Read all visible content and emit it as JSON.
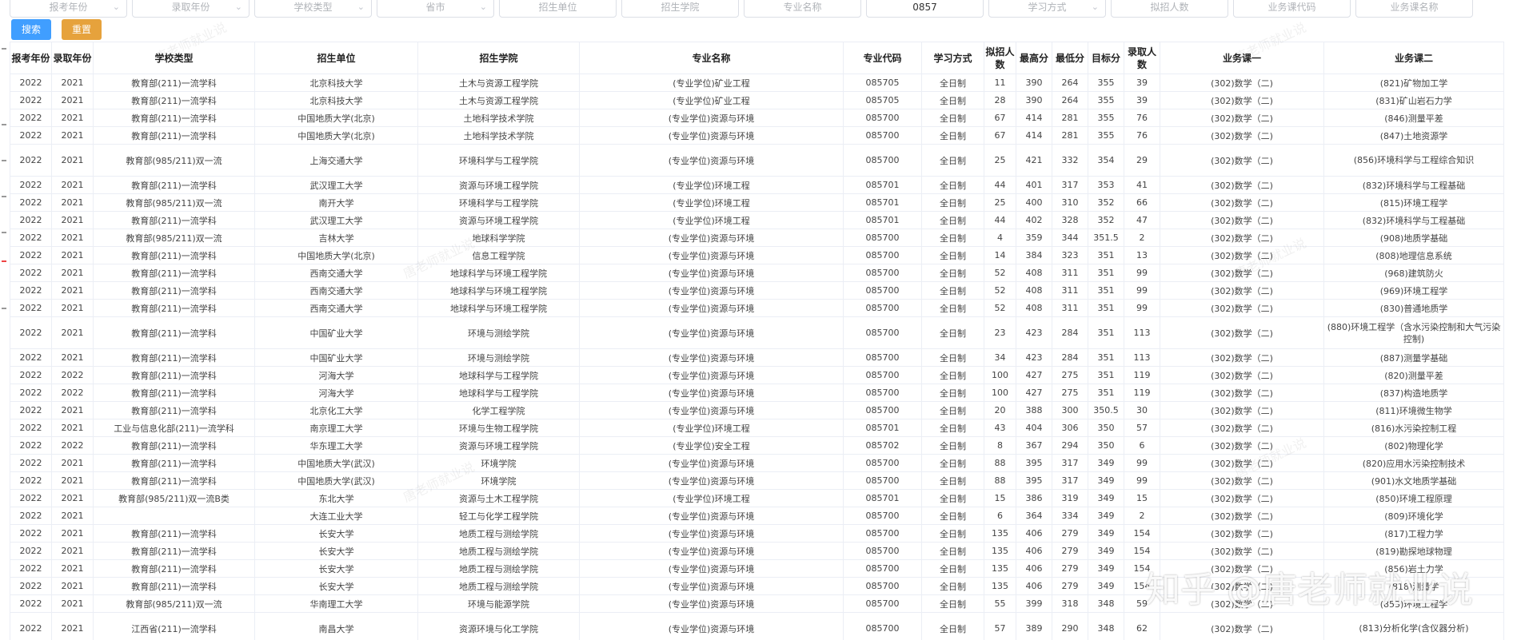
{
  "filters": [
    {
      "placeholder": "报考年份",
      "value": "",
      "dropdown": true
    },
    {
      "placeholder": "录取年份",
      "value": "",
      "dropdown": true
    },
    {
      "placeholder": "学校类型",
      "value": "",
      "dropdown": true
    },
    {
      "placeholder": "省市",
      "value": "",
      "dropdown": true
    },
    {
      "placeholder": "招生单位",
      "value": "",
      "dropdown": false
    },
    {
      "placeholder": "招生学院",
      "value": "",
      "dropdown": false
    },
    {
      "placeholder": "专业名称",
      "value": "",
      "dropdown": false
    },
    {
      "placeholder": "",
      "value": "0857",
      "dropdown": false
    },
    {
      "placeholder": "学习方式",
      "value": "",
      "dropdown": true
    },
    {
      "placeholder": "拟招人数",
      "value": "",
      "dropdown": false
    },
    {
      "placeholder": "业务课代码",
      "value": "",
      "dropdown": false
    },
    {
      "placeholder": "业务课名称",
      "value": "",
      "dropdown": false
    }
  ],
  "buttons": {
    "search": "搜索",
    "reset": "重置"
  },
  "columns": [
    "报考年份",
    "录取年份",
    "学校类型",
    "招生单位",
    "招生学院",
    "专业名称",
    "专业代码",
    "学习方式",
    "拟招人数",
    "最高分",
    "最低分",
    "目标分",
    "录取人数",
    "业务课一",
    "业务课二"
  ],
  "rows": [
    [
      "2022",
      "2021",
      "教育部(211)一流学科",
      "北京科技大学",
      "土木与资源工程学院",
      "(专业学位)矿业工程",
      "085705",
      "全日制",
      "11",
      "390",
      "264",
      "355",
      "39",
      "(302)数学（二)",
      "(821)矿物加工学"
    ],
    [
      "2022",
      "2021",
      "教育部(211)一流学科",
      "北京科技大学",
      "土木与资源工程学院",
      "(专业学位)矿业工程",
      "085705",
      "全日制",
      "28",
      "390",
      "264",
      "355",
      "39",
      "(302)数学（二)",
      "(831)矿山岩石力学"
    ],
    [
      "2022",
      "2021",
      "教育部(211)一流学科",
      "中国地质大学(北京)",
      "土地科学技术学院",
      "(专业学位)资源与环境",
      "085700",
      "全日制",
      "67",
      "414",
      "281",
      "355",
      "76",
      "(302)数学（二)",
      "(846)测量平差"
    ],
    [
      "2022",
      "2021",
      "教育部(211)一流学科",
      "中国地质大学(北京)",
      "土地科学技术学院",
      "(专业学位)资源与环境",
      "085700",
      "全日制",
      "67",
      "414",
      "281",
      "355",
      "76",
      "(302)数学（二)",
      "(847)土地资源学"
    ],
    [
      "2022",
      "2021",
      "教育部(985/211)双一流",
      "上海交通大学",
      "环境科学与工程学院",
      "(专业学位)资源与环境",
      "085700",
      "全日制",
      "25",
      "421",
      "332",
      "354",
      "29",
      "(302)数学（二)",
      "(856)环境科学与工程综合知识"
    ],
    [
      "2022",
      "2021",
      "教育部(211)一流学科",
      "武汉理工大学",
      "资源与环境工程学院",
      "(专业学位)环境工程",
      "085701",
      "全日制",
      "44",
      "401",
      "317",
      "353",
      "41",
      "(302)数学（二)",
      "(832)环境科学与工程基础"
    ],
    [
      "2022",
      "2021",
      "教育部(985/211)双一流",
      "南开大学",
      "环境科学与工程学院",
      "(专业学位)环境工程",
      "085701",
      "全日制",
      "25",
      "400",
      "310",
      "352",
      "66",
      "(302)数学（二)",
      "(815)环境工程学"
    ],
    [
      "2022",
      "2021",
      "教育部(211)一流学科",
      "武汉理工大学",
      "资源与环境工程学院",
      "(专业学位)环境工程",
      "085701",
      "全日制",
      "44",
      "402",
      "328",
      "352",
      "47",
      "(302)数学（二)",
      "(832)环境科学与工程基础"
    ],
    [
      "2022",
      "2021",
      "教育部(985/211)双一流",
      "吉林大学",
      "地球科学学院",
      "(专业学位)资源与环境",
      "085700",
      "全日制",
      "4",
      "359",
      "344",
      "351.5",
      "2",
      "(302)数学（二)",
      "(908)地质学基础"
    ],
    [
      "2022",
      "2021",
      "教育部(211)一流学科",
      "中国地质大学(北京)",
      "信息工程学院",
      "(专业学位)资源与环境",
      "085700",
      "全日制",
      "14",
      "384",
      "323",
      "351",
      "13",
      "(302)数学（二)",
      "(808)地理信息系统"
    ],
    [
      "2022",
      "2021",
      "教育部(211)一流学科",
      "西南交通大学",
      "地球科学与环境工程学院",
      "(专业学位)资源与环境",
      "085700",
      "全日制",
      "52",
      "408",
      "311",
      "351",
      "99",
      "(302)数学（二)",
      "(968)建筑防火"
    ],
    [
      "2022",
      "2021",
      "教育部(211)一流学科",
      "西南交通大学",
      "地球科学与环境工程学院",
      "(专业学位)资源与环境",
      "085700",
      "全日制",
      "52",
      "408",
      "311",
      "351",
      "99",
      "(302)数学（二)",
      "(969)环境工程学"
    ],
    [
      "2022",
      "2021",
      "教育部(211)一流学科",
      "西南交通大学",
      "地球科学与环境工程学院",
      "(专业学位)资源与环境",
      "085700",
      "全日制",
      "52",
      "408",
      "311",
      "351",
      "99",
      "(302)数学（二)",
      "(830)普通地质学"
    ],
    [
      "2022",
      "2021",
      "教育部(211)一流学科",
      "中国矿业大学",
      "环境与测绘学院",
      "(专业学位)资源与环境",
      "085700",
      "全日制",
      "23",
      "423",
      "284",
      "351",
      "113",
      "(302)数学（二)",
      "(880)环境工程学（含水污染控制和大气污染控制)"
    ],
    [
      "2022",
      "2021",
      "教育部(211)一流学科",
      "中国矿业大学",
      "环境与测绘学院",
      "(专业学位)资源与环境",
      "085700",
      "全日制",
      "34",
      "423",
      "284",
      "351",
      "113",
      "(302)数学（二)",
      "(887)测量学基础"
    ],
    [
      "2022",
      "2022",
      "教育部(211)一流学科",
      "河海大学",
      "地球科学与工程学院",
      "(专业学位)资源与环境",
      "085700",
      "全日制",
      "100",
      "427",
      "275",
      "351",
      "119",
      "(302)数学（二)",
      "(820)测量平差"
    ],
    [
      "2022",
      "2022",
      "教育部(211)一流学科",
      "河海大学",
      "地球科学与工程学院",
      "(专业学位)资源与环境",
      "085700",
      "全日制",
      "100",
      "427",
      "275",
      "351",
      "119",
      "(302)数学（二)",
      "(837)构造地质学"
    ],
    [
      "2022",
      "2021",
      "教育部(211)一流学科",
      "北京化工大学",
      "化学工程学院",
      "(专业学位)资源与环境",
      "085700",
      "全日制",
      "20",
      "388",
      "300",
      "350.5",
      "30",
      "(302)数学（二)",
      "(811)环境微生物学"
    ],
    [
      "2022",
      "2021",
      "工业与信息化部(211)一流学科",
      "南京理工大学",
      "环境与生物工程学院",
      "(专业学位)环境工程",
      "085701",
      "全日制",
      "43",
      "404",
      "306",
      "350",
      "57",
      "(302)数学（二)",
      "(816)水污染控制工程"
    ],
    [
      "2022",
      "2022",
      "教育部(211)一流学科",
      "华东理工大学",
      "资源与环境工程学院",
      "(专业学位)安全工程",
      "085702",
      "全日制",
      "8",
      "367",
      "294",
      "350",
      "6",
      "(302)数学（二)",
      "(802)物理化学"
    ],
    [
      "2022",
      "2021",
      "教育部(211)一流学科",
      "中国地质大学(武汉)",
      "环境学院",
      "(专业学位)资源与环境",
      "085700",
      "全日制",
      "88",
      "395",
      "317",
      "349",
      "99",
      "(302)数学（二)",
      "(820)应用水污染控制技术"
    ],
    [
      "2022",
      "2021",
      "教育部(211)一流学科",
      "中国地质大学(武汉)",
      "环境学院",
      "(专业学位)资源与环境",
      "085700",
      "全日制",
      "88",
      "395",
      "317",
      "349",
      "99",
      "(302)数学（二)",
      "(901)水文地质学基础"
    ],
    [
      "2022",
      "2021",
      "教育部(985/211)双一流B类",
      "东北大学",
      "资源与土木工程学院",
      "(专业学位)环境工程",
      "085701",
      "全日制",
      "15",
      "386",
      "319",
      "349",
      "15",
      "(302)数学（二)",
      "(850)环境工程原理"
    ],
    [
      "2022",
      "2021",
      "",
      "大连工业大学",
      "轻工与化学工程学院",
      "(专业学位)资源与环境",
      "085700",
      "全日制",
      "6",
      "364",
      "334",
      "349",
      "2",
      "(302)数学（二)",
      "(809)环境化学"
    ],
    [
      "2022",
      "2021",
      "教育部(211)一流学科",
      "长安大学",
      "地质工程与测绘学院",
      "(专业学位)资源与环境",
      "085700",
      "全日制",
      "135",
      "406",
      "279",
      "349",
      "154",
      "(302)数学（二)",
      "(817)工程力学"
    ],
    [
      "2022",
      "2021",
      "教育部(211)一流学科",
      "长安大学",
      "地质工程与测绘学院",
      "(专业学位)资源与环境",
      "085700",
      "全日制",
      "135",
      "406",
      "279",
      "349",
      "154",
      "(302)数学（二)",
      "(819)勘探地球物理"
    ],
    [
      "2022",
      "2021",
      "教育部(211)一流学科",
      "长安大学",
      "地质工程与测绘学院",
      "(专业学位)资源与环境",
      "085700",
      "全日制",
      "135",
      "406",
      "279",
      "349",
      "154",
      "(302)数学（二)",
      "(856)岩土力学"
    ],
    [
      "2022",
      "2021",
      "教育部(211)一流学科",
      "长安大学",
      "地质工程与测绘学院",
      "(专业学位)资源与环境",
      "085700",
      "全日制",
      "135",
      "406",
      "279",
      "349",
      "154",
      "(302)数学（二)",
      "(818)测量学"
    ],
    [
      "2022",
      "2021",
      "教育部(985/211)双一流",
      "华南理工大学",
      "环境与能源学院",
      "(专业学位)资源与环境",
      "085700",
      "全日制",
      "55",
      "399",
      "318",
      "348",
      "59",
      "(302)数学（二)",
      "(853)环境工程学"
    ],
    [
      "2022",
      "2021",
      "江西省(211)一流学科",
      "南昌大学",
      "资源环境与化工学院",
      "(专业学位)资源与环境",
      "085700",
      "全日制",
      "57",
      "389",
      "290",
      "348",
      "62",
      "(302)数学（二)",
      "(813)分析化学(含仪器分析)"
    ]
  ],
  "watermark_text": "唐老师就业说",
  "zhihu_watermark": "知乎 @唐老师就业说"
}
